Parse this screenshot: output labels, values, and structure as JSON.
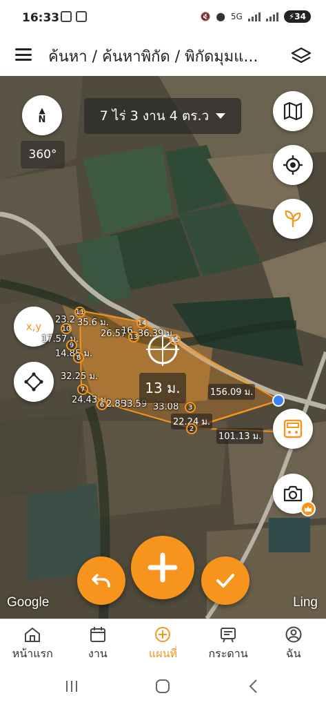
{
  "status_bar": {
    "time": "16:33",
    "network": "5G",
    "battery": "34"
  },
  "header": {
    "title": "ค้นหา / ค้นหาพิกัด / พิกัดมุมแ..."
  },
  "map": {
    "compass_label": "N",
    "rotation_label": "360°",
    "area_text": "7 ไร่ 3 งาน 4 ตร.ว",
    "xy_label": "x,y",
    "center_distance": "13 ม.",
    "attribution_left": "Google",
    "attribution_right": "Ling",
    "segment_labels": [
      "23.2",
      "35.6 ม.",
      "17.57 ม.",
      "14.85 ม.",
      "32.25 ม.",
      "24.43 ม.",
      "2.85",
      "33.59",
      "33.08",
      "22.24 ม.",
      "101.13 ม.",
      "156.09 ม.",
      "36.39 ม.",
      "26.57",
      "16"
    ],
    "points": [
      "11",
      "10",
      "9",
      "8",
      "7",
      "6",
      "13",
      "14",
      "3",
      "2",
      "15"
    ]
  },
  "bottom_nav": {
    "items": [
      {
        "label": "หน้าแรก",
        "icon": "home-icon"
      },
      {
        "label": "งาน",
        "icon": "calendar-icon"
      },
      {
        "label": "แผนที่",
        "icon": "map-plus-icon"
      },
      {
        "label": "กระดาน",
        "icon": "board-icon"
      },
      {
        "label": "ฉัน",
        "icon": "user-icon"
      }
    ],
    "active_index": 2
  },
  "colors": {
    "accent": "#f7941d",
    "text": "#222222"
  }
}
